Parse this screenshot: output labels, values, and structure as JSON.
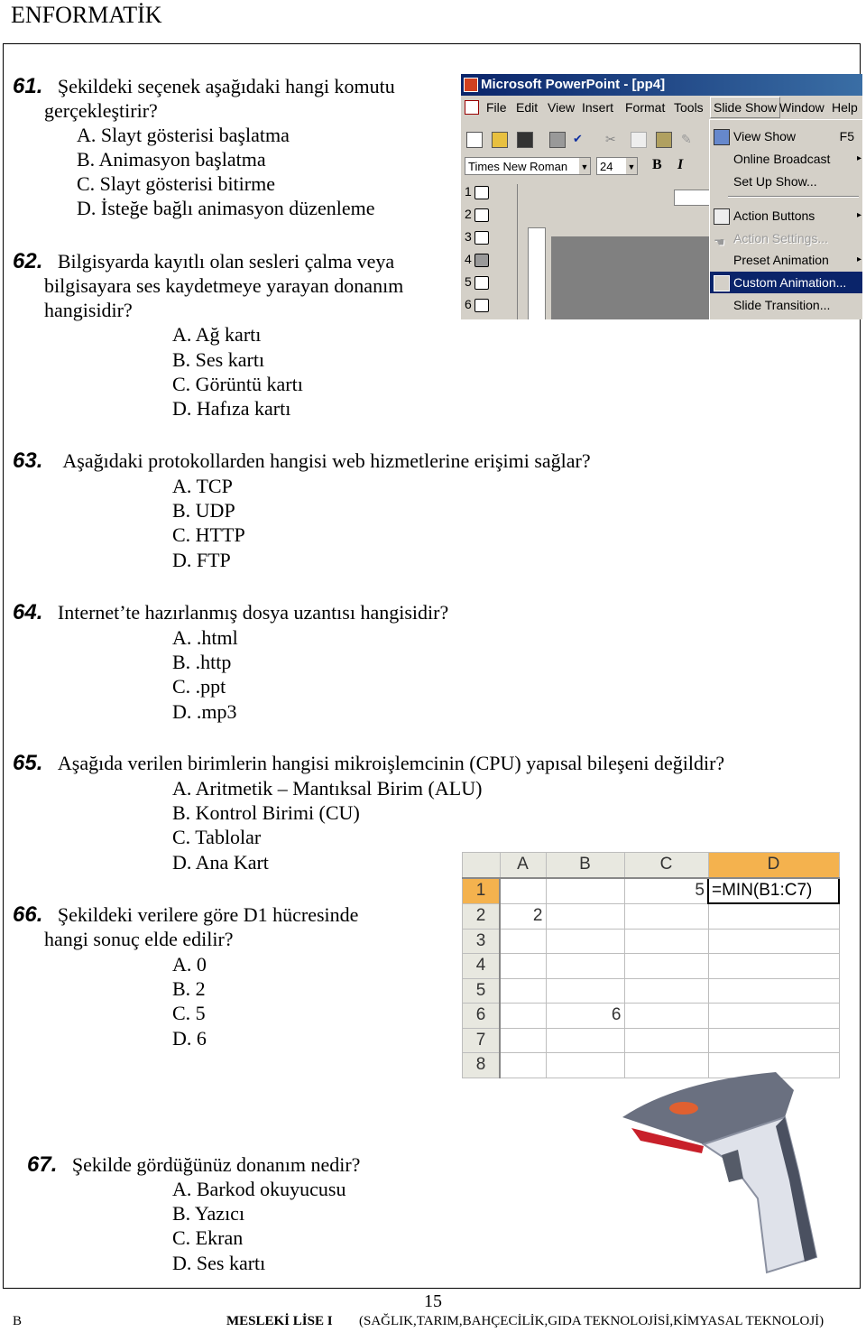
{
  "header": {
    "title": "ENFORMATİK"
  },
  "questions": [
    {
      "number": "61.",
      "text_line1": "Şekildeki seçenek aşağıdaki hangi komutu",
      "text_line2": "gerçekleştirir?",
      "options": [
        "A. Slayt gösterisi başlatma",
        "B. Animasyon başlatma",
        "C. Slayt gösterisi bitirme",
        "D. İsteğe bağlı animasyon düzenleme"
      ]
    },
    {
      "number": "62.",
      "text_line1": "Bilgisyarda kayıtlı olan sesleri çalma veya",
      "text_line2": "bilgisayara ses kaydetmeye yarayan donanım",
      "text_line3": "hangisidir?",
      "options": [
        "A. Ağ kartı",
        "B. Ses kartı",
        "C. Görüntü kartı",
        "D. Hafıza kartı"
      ]
    },
    {
      "number": "63.",
      "text_line1": "Aşağıdaki protokollarden hangisi web hizmetlerine erişimi sağlar?",
      "options": [
        "A. TCP",
        "B. UDP",
        "C. HTTP",
        "D. FTP"
      ]
    },
    {
      "number": "64.",
      "text_line1": "Internet’te hazırlanmış dosya uzantısı hangisidir?",
      "options": [
        "A. .html",
        "B. .http",
        "C. .ppt",
        "D. .mp3"
      ]
    },
    {
      "number": "65.",
      "text_line1": "Aşağıda verilen birimlerin hangisi mikroişlemcinin  (CPU) yapısal bileşeni değildir?",
      "options": [
        "A. Aritmetik – Mantıksal Birim (ALU)",
        "B. Kontrol Birimi (CU)",
        "C. Tablolar",
        "D. Ana Kart"
      ]
    },
    {
      "number": "66.",
      "text_line1": "Şekildeki verilere göre D1 hücresinde",
      "text_line2": "hangi sonuç elde edilir?",
      "options": [
        "A. 0",
        "B. 2",
        "C. 5",
        "D. 6"
      ]
    },
    {
      "number": "67.",
      "text_line1": "Şekilde gördüğünüz donanım nedir?",
      "options": [
        "A. Barkod okuyucusu",
        "B. Yazıcı",
        "C. Ekran",
        "D. Ses kartı"
      ]
    }
  ],
  "powerpoint": {
    "title": "Microsoft PowerPoint - [pp4]",
    "menubar": [
      "File",
      "Edit",
      "View",
      "Insert",
      "Format",
      "Tools",
      "Slide Show",
      "Window",
      "Help"
    ],
    "font_name": "Times New Roman",
    "font_size": "24",
    "slide_numbers": [
      "1",
      "2",
      "3",
      "4",
      "5",
      "6"
    ],
    "menu_items": [
      {
        "label": "View Show",
        "shortcut": "F5"
      },
      {
        "label": "Online Broadcast",
        "submenu": "▸"
      },
      {
        "label": "Set Up Show..."
      },
      {
        "label": "Action Buttons",
        "submenu": "▸"
      },
      {
        "label": "Action Settings..."
      },
      {
        "label": "Preset Animation",
        "submenu": "▸"
      },
      {
        "label": "Custom Animation..."
      },
      {
        "label": "Slide Transition..."
      }
    ]
  },
  "spreadsheet": {
    "columns": [
      "A",
      "B",
      "C",
      "D"
    ],
    "rows": [
      {
        "n": "1",
        "A": "",
        "B": "",
        "C": "5",
        "D": "=MIN(B1:C7)"
      },
      {
        "n": "2",
        "A": "2",
        "B": "",
        "C": "",
        "D": ""
      },
      {
        "n": "3",
        "A": "",
        "B": "",
        "C": "",
        "D": ""
      },
      {
        "n": "4",
        "A": "",
        "B": "",
        "C": "",
        "D": ""
      },
      {
        "n": "5",
        "A": "",
        "B": "",
        "C": "",
        "D": ""
      },
      {
        "n": "6",
        "A": "",
        "B": "6",
        "C": "",
        "D": ""
      },
      {
        "n": "7",
        "A": "",
        "B": "",
        "C": "",
        "D": ""
      },
      {
        "n": "8",
        "A": "",
        "B": "",
        "C": "",
        "D": ""
      }
    ]
  },
  "footer": {
    "page": "15",
    "left": "B",
    "school": "MESLEKİ LİSE I",
    "fields": "(SAĞLIK,TARIM,BAHÇECİLİK,GIDA TEKNOLOJİSİ,KİMYASAL TEKNOLOJİ)"
  }
}
